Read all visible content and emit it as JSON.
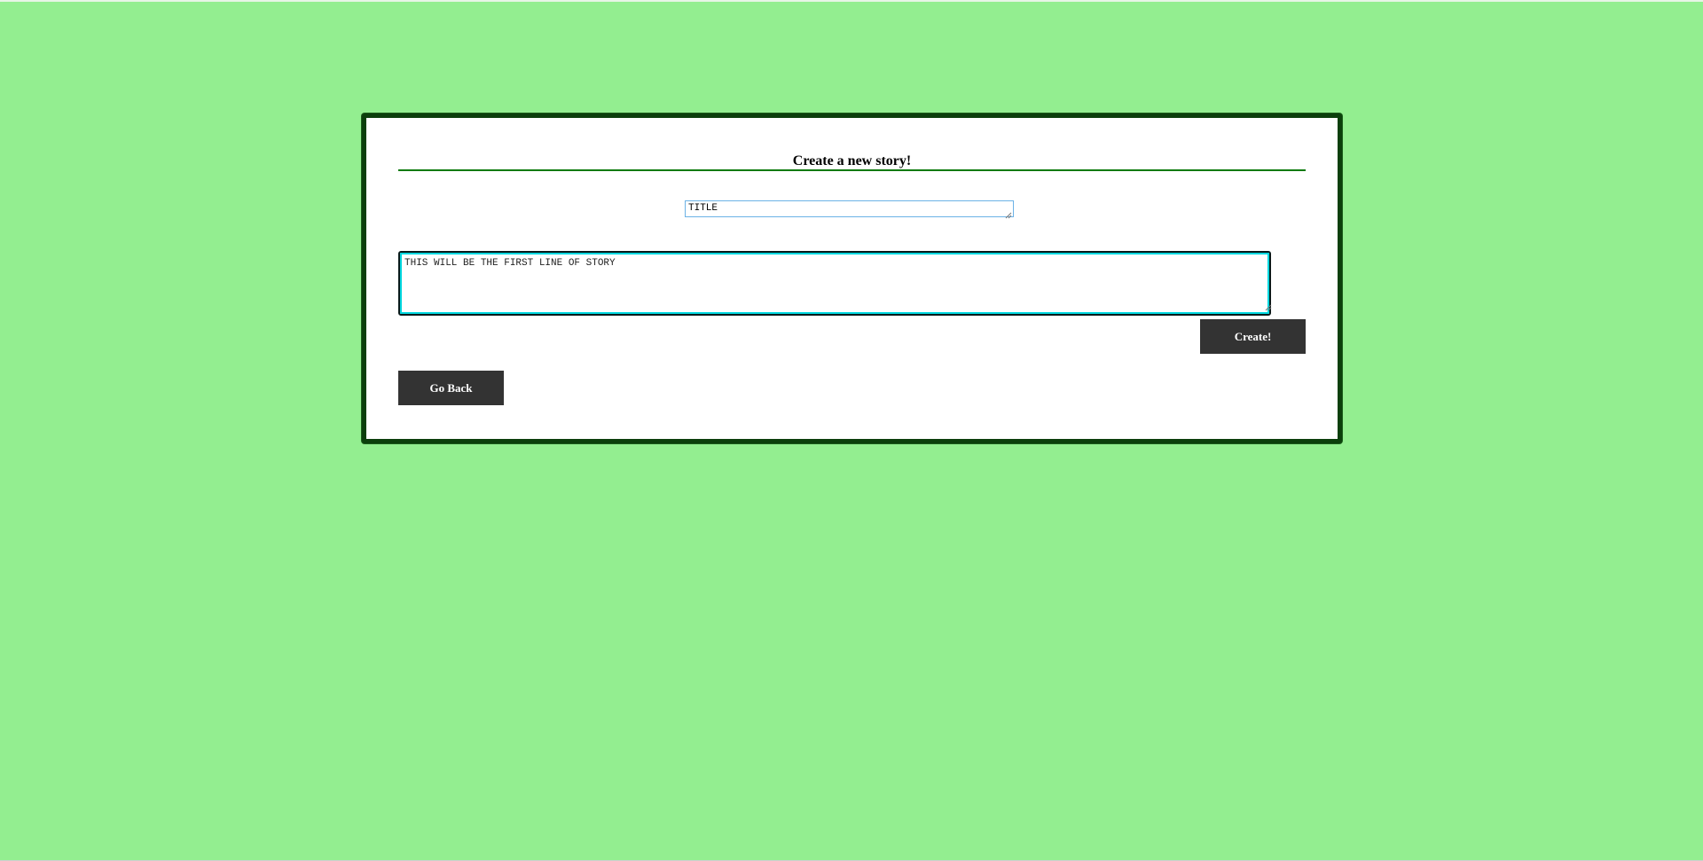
{
  "page": {
    "heading": "Create a new story!"
  },
  "form": {
    "title_value": "TITLE",
    "story_value": "THIS WILL BE THE FIRST LINE OF STORY",
    "create_label": "Create!",
    "back_label": "Go Back"
  },
  "colors": {
    "background": "#93ee90",
    "card_border": "#0c3f0c",
    "heading_rule": "#0a7a0a",
    "button_bg": "#333333",
    "button_text": "#ffffff",
    "focus_ring": "#00d8e0",
    "title_input_border": "#6cb2e6"
  }
}
